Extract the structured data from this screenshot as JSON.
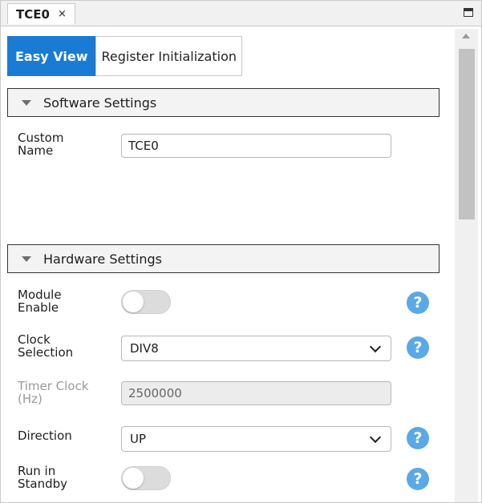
{
  "doc_tab": {
    "title": "TCE0",
    "close": "×"
  },
  "tabs": [
    "Easy View",
    "Register Initialization"
  ],
  "software": {
    "header": "Software Settings",
    "custom_name_label": "Custom\nName",
    "custom_name_value": "TCE0"
  },
  "hardware": {
    "header": "Hardware Settings",
    "module_enable_label": "Module\nEnable",
    "module_enable": false,
    "clock_selection_label": "Clock\nSelection",
    "clock_selection_value": "DIV8",
    "timer_clock_label": "Timer Clock\n(Hz)",
    "timer_clock_value": "2500000",
    "direction_label": "Direction",
    "direction_value": "UP",
    "run_in_standby_label": "Run in\nStandby",
    "run_in_standby": false
  },
  "help_glyph": "?",
  "colors": {
    "accent": "#1a7bd4",
    "help": "#5aa9e6"
  }
}
